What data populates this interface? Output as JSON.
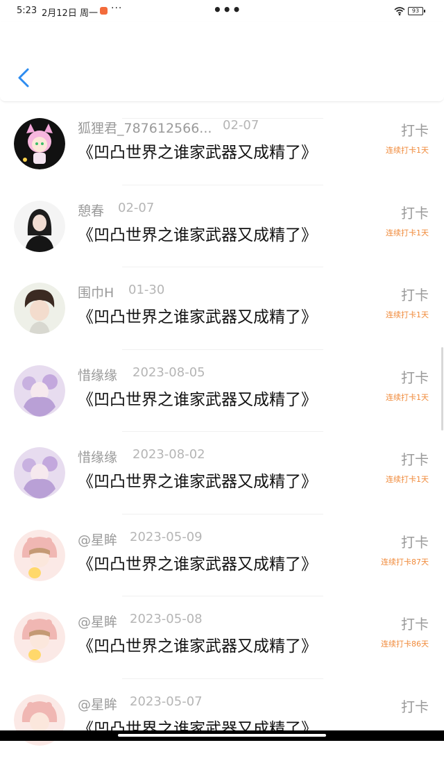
{
  "status_bar": {
    "time": "5:23",
    "date": "2月12日 周一",
    "more": "···",
    "center_dots": "•••",
    "battery": "93"
  },
  "header": {
    "back_icon": "chevron-left-icon",
    "accent_color": "#2d8cf0"
  },
  "list": {
    "items": [
      {
        "name": "狐狸君_787612566...",
        "date": "02-07",
        "title": "《凹凸世界之谁家武器又成精了》",
        "action": "打卡",
        "streak": "连续打卡1天",
        "avatar": "avatar-pink-girl"
      },
      {
        "name": "憩春",
        "date": "02-07",
        "title": "《凹凸世界之谁家武器又成精了》",
        "action": "打卡",
        "streak": "连续打卡1天",
        "avatar": "avatar-dark-hair-girl"
      },
      {
        "name": "围巾H",
        "date": "01-30",
        "title": "《凹凸世界之谁家武器又成精了》",
        "action": "打卡",
        "streak": "连续打卡1天",
        "avatar": "avatar-boy"
      },
      {
        "name": "惜缘缘",
        "date": "2023-08-05",
        "title": "《凹凸世界之谁家武器又成精了》",
        "action": "打卡",
        "streak": "连续打卡1天",
        "avatar": "avatar-purple-girl"
      },
      {
        "name": "惜缘缘",
        "date": "2023-08-02",
        "title": "《凹凸世界之谁家武器又成精了》",
        "action": "打卡",
        "streak": "连续打卡1天",
        "avatar": "avatar-purple-girl"
      },
      {
        "name": "@星眸",
        "date": "2023-05-09",
        "title": "《凹凸世界之谁家武器又成精了》",
        "action": "打卡",
        "streak": "连续打卡87天",
        "avatar": "avatar-bunny-hood"
      },
      {
        "name": "@星眸",
        "date": "2023-05-08",
        "title": "《凹凸世界之谁家武器又成精了》",
        "action": "打卡",
        "streak": "连续打卡86天",
        "avatar": "avatar-bunny-hood"
      },
      {
        "name": "@星眸",
        "date": "2023-05-07",
        "title": "《凹凸世界之谁家武器又成精了》",
        "action": "打卡",
        "streak": "",
        "avatar": "avatar-bunny-hood"
      }
    ]
  }
}
